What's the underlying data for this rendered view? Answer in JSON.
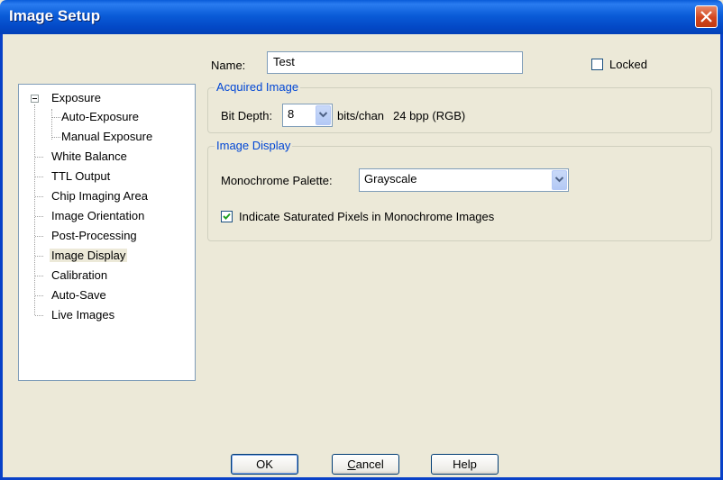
{
  "window": {
    "title": "Image Setup",
    "close_icon": "close-icon"
  },
  "name_field": {
    "label": "Name:",
    "value": "Test"
  },
  "locked": {
    "label": "Locked",
    "checked": false
  },
  "tree": {
    "items": [
      {
        "label": "Exposure",
        "expanded": true
      },
      {
        "label": "Auto-Exposure"
      },
      {
        "label": "Manual Exposure"
      },
      {
        "label": "White Balance"
      },
      {
        "label": "TTL Output"
      },
      {
        "label": "Chip Imaging Area"
      },
      {
        "label": "Image Orientation"
      },
      {
        "label": "Post-Processing"
      },
      {
        "label": "Image Display",
        "selected": true
      },
      {
        "label": "Calibration"
      },
      {
        "label": "Auto-Save"
      },
      {
        "label": "Live Images"
      }
    ]
  },
  "acquired_image": {
    "title": "Acquired Image",
    "bit_depth_label": "Bit Depth:",
    "bit_depth_value": "8",
    "units": "bits/chan",
    "bpp": "24 bpp (RGB)"
  },
  "image_display": {
    "title": "Image Display",
    "palette_label": "Monochrome Palette:",
    "palette_value": "Grayscale",
    "saturated_label": "Indicate Saturated Pixels in Monochrome Images",
    "saturated_checked": true
  },
  "buttons": {
    "ok": "OK",
    "cancel_first": "C",
    "cancel_rest": "ancel",
    "help": "Help"
  },
  "colors": {
    "titlebar": "#0a5cd8",
    "group_title": "#0046d5",
    "dialog_bg": "#ece9d8",
    "check": "#21a121"
  }
}
